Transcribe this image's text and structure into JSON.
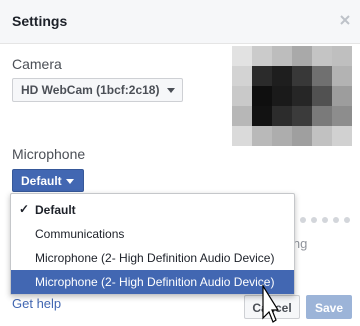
{
  "dialog": {
    "title": "Settings",
    "close_icon": "close-icon"
  },
  "camera": {
    "label": "Camera",
    "selected": "HD WebCam (1bcf:2c18)"
  },
  "microphone": {
    "label": "Microphone",
    "selected": "Default"
  },
  "mic_menu": {
    "items": [
      {
        "label": "Default",
        "checked": true
      },
      {
        "label": "Communications",
        "checked": false
      },
      {
        "label": "Microphone (2- High Definition Audio Device)",
        "checked": false
      },
      {
        "label": "Microphone (2- High Definition Audio Device)",
        "checked": false,
        "highlighted": true
      }
    ]
  },
  "partial_text": "ing",
  "footer": {
    "help_link": "Get help",
    "cancel_label": "Cancel",
    "save_label": "Save"
  },
  "colors": {
    "accent": "#4267b2",
    "save_disabled": "#9cb4d8",
    "header_bg": "#f6f7f9"
  }
}
